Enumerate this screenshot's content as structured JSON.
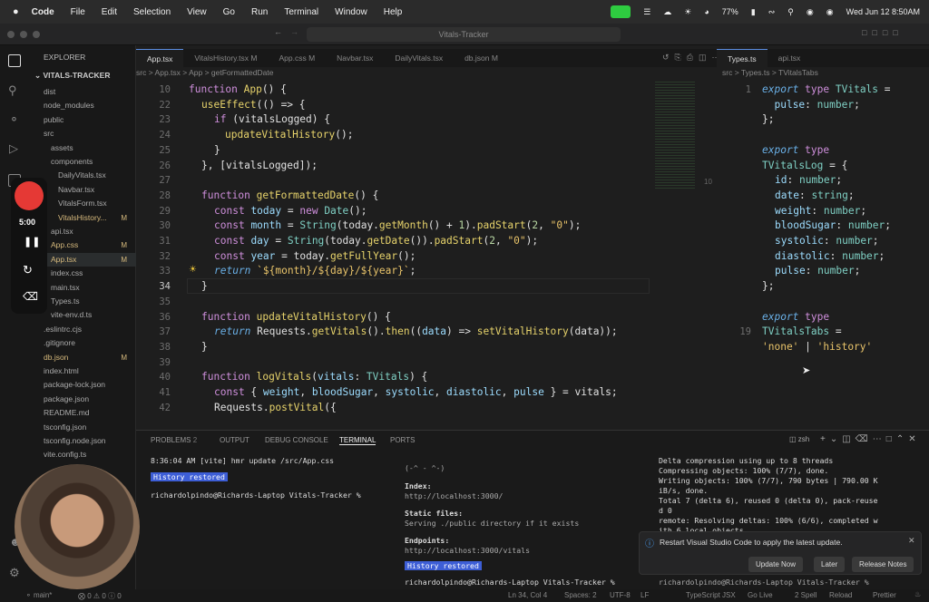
{
  "menubar": {
    "app": "Code",
    "items": [
      "File",
      "Edit",
      "Selection",
      "View",
      "Go",
      "Run",
      "Terminal",
      "Window",
      "Help"
    ],
    "battery": "77%",
    "datetime": "Wed Jun 12  8:50AM"
  },
  "window": {
    "title": "Vitals-Tracker"
  },
  "sidebar": {
    "header": "EXPLORER",
    "project": "VITALS-TRACKER",
    "items": [
      {
        "label": "dist",
        "indent": 1,
        "badge": ""
      },
      {
        "label": "node_modules",
        "indent": 1,
        "badge": ""
      },
      {
        "label": "public",
        "indent": 1,
        "badge": ""
      },
      {
        "label": "src",
        "indent": 1,
        "badge": ""
      },
      {
        "label": "assets",
        "indent": 2,
        "badge": ""
      },
      {
        "label": "components",
        "indent": 2,
        "badge": ""
      },
      {
        "label": "DailyVitals.tsx",
        "indent": 3,
        "badge": ""
      },
      {
        "label": "Navbar.tsx",
        "indent": 3,
        "badge": ""
      },
      {
        "label": "VitalsForm.tsx",
        "indent": 3,
        "badge": ""
      },
      {
        "label": "VitalsHistory...",
        "indent": 3,
        "badge": "M"
      },
      {
        "label": "api.tsx",
        "indent": 2,
        "badge": ""
      },
      {
        "label": "App.css",
        "indent": 2,
        "badge": "M"
      },
      {
        "label": "App.tsx",
        "indent": 2,
        "badge": "M"
      },
      {
        "label": "index.css",
        "indent": 2,
        "badge": ""
      },
      {
        "label": "main.tsx",
        "indent": 2,
        "badge": ""
      },
      {
        "label": "Types.ts",
        "indent": 2,
        "badge": ""
      },
      {
        "label": "vite-env.d.ts",
        "indent": 2,
        "badge": ""
      },
      {
        "label": ".eslintrc.cjs",
        "indent": 1,
        "badge": ""
      },
      {
        "label": ".gitignore",
        "indent": 1,
        "badge": ""
      },
      {
        "label": "db.json",
        "indent": 1,
        "badge": "M"
      },
      {
        "label": "index.html",
        "indent": 1,
        "badge": ""
      },
      {
        "label": "package-lock.json",
        "indent": 1,
        "badge": ""
      },
      {
        "label": "package.json",
        "indent": 1,
        "badge": ""
      },
      {
        "label": "README.md",
        "indent": 1,
        "badge": ""
      },
      {
        "label": "tsconfig.json",
        "indent": 1,
        "badge": ""
      },
      {
        "label": "tsconfig.node.json",
        "indent": 1,
        "badge": ""
      },
      {
        "label": "vite.config.ts",
        "indent": 1,
        "badge": ""
      }
    ]
  },
  "tabs": [
    {
      "label": "App.tsx",
      "active": true
    },
    {
      "label": "VitalsHistory.tsx M",
      "active": false
    },
    {
      "label": "App.css M",
      "active": false
    },
    {
      "label": "Navbar.tsx",
      "active": false
    },
    {
      "label": "DailyVitals.tsx",
      "active": false
    },
    {
      "label": "db.json M",
      "active": false
    }
  ],
  "tabs2": [
    {
      "label": "Types.ts",
      "active": true
    },
    {
      "label": "api.tsx",
      "active": false
    }
  ],
  "breadcrumb": "src  >  App.tsx  >  App  >  getFormattedDate",
  "breadcrumb2": "src  >  Types.ts  >  TVitalsTabs",
  "editor": {
    "lines": [
      "10",
      "22",
      "23",
      "24",
      "25",
      "26",
      "27",
      "28",
      "29",
      "30",
      "31",
      "32",
      "33",
      "34",
      "35",
      "36",
      "37",
      "38",
      "39",
      "40",
      "41",
      "42"
    ]
  },
  "editor2": {
    "lines": [
      "1",
      "",
      "",
      "",
      "",
      "",
      "",
      "",
      "",
      "",
      "",
      "",
      "",
      "",
      "",
      "",
      "19"
    ]
  },
  "panel": {
    "tabs": [
      "PROBLEMS",
      "OUTPUT",
      "DEBUG CONSOLE",
      "TERMINAL",
      "PORTS"
    ],
    "problems_count": "2",
    "shell": "zsh"
  },
  "terminal1": {
    "line1": "8:36:04 AM [vite] hmr update /src/App.css",
    "badge": "History restored",
    "prompt": "richardolpindo@Richards-Laptop Vitals-Tracker %"
  },
  "terminal2": {
    "face": "(-^ - ^-)",
    "index_label": "Index:",
    "index_url": "http://localhost:3000/",
    "static_label": "Static files:",
    "static_text": "Serving ./public directory if it exists",
    "endpoints_label": "Endpoints:",
    "endpoints_url": "http://localhost:3000/vitals",
    "badge": "History restored",
    "prompt": "richardolpindo@Richards-Laptop Vitals-Tracker %"
  },
  "terminal3": {
    "text": "Delta compression using up to 8 threads\nCompressing objects: 100% (7/7), done.\nWriting objects: 100% (7/7), 790 bytes | 790.00 K\niB/s, done.\nTotal 7 (delta 6), reused 0 (delta 0), pack-reuse\nd 0\nremote: Resolving deltas: 100% (6/6), completed w\nith 6 local objects.",
    "prompt": "richardolpindo@Richards-Laptop Vitals-Tracker %"
  },
  "notification": {
    "text": "Restart Visual Studio Code to apply the latest update.",
    "btn_update": "Update Now",
    "btn_later": "Later",
    "btn_notes": "Release Notes"
  },
  "statusbar": {
    "branch": "main*",
    "errors": "0",
    "warnings": "0",
    "info": "0",
    "position": "Ln 34, Col 4",
    "spaces": "Spaces: 2",
    "encoding": "UTF-8",
    "eol": "LF",
    "language": "TypeScript JSX",
    "golive": "Go Live",
    "spell": "2 Spell",
    "reload": "Reload",
    "prettier": "Prettier"
  },
  "recorder": {
    "time": "5:00"
  }
}
